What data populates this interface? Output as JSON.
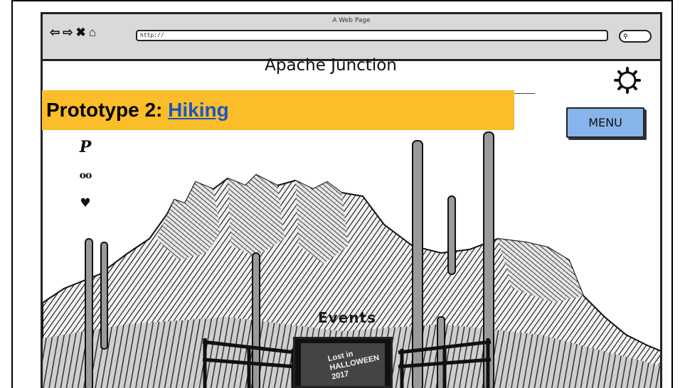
{
  "browser": {
    "window_title": "A Web Page",
    "url": "http://",
    "search_icon": "magnifier-icon"
  },
  "site": {
    "title": "Apache Junction",
    "settings_icon": "gear-icon"
  },
  "banner": {
    "prefix": "Prototype 2: ",
    "link": "Hiking",
    "color": "#fbbd29",
    "link_color": "#1a56c4"
  },
  "menu": {
    "label": "MENU",
    "color": "#88b4ec"
  },
  "social": [
    {
      "icon": "pinterest-icon",
      "glyph": "P"
    },
    {
      "icon": "tripadvisor-icon",
      "glyph": "oo"
    },
    {
      "icon": "twitter-icon",
      "glyph": "♥"
    }
  ],
  "events": {
    "label": "Events",
    "poster_text": "Lost in HALLOWEEN 2017"
  }
}
